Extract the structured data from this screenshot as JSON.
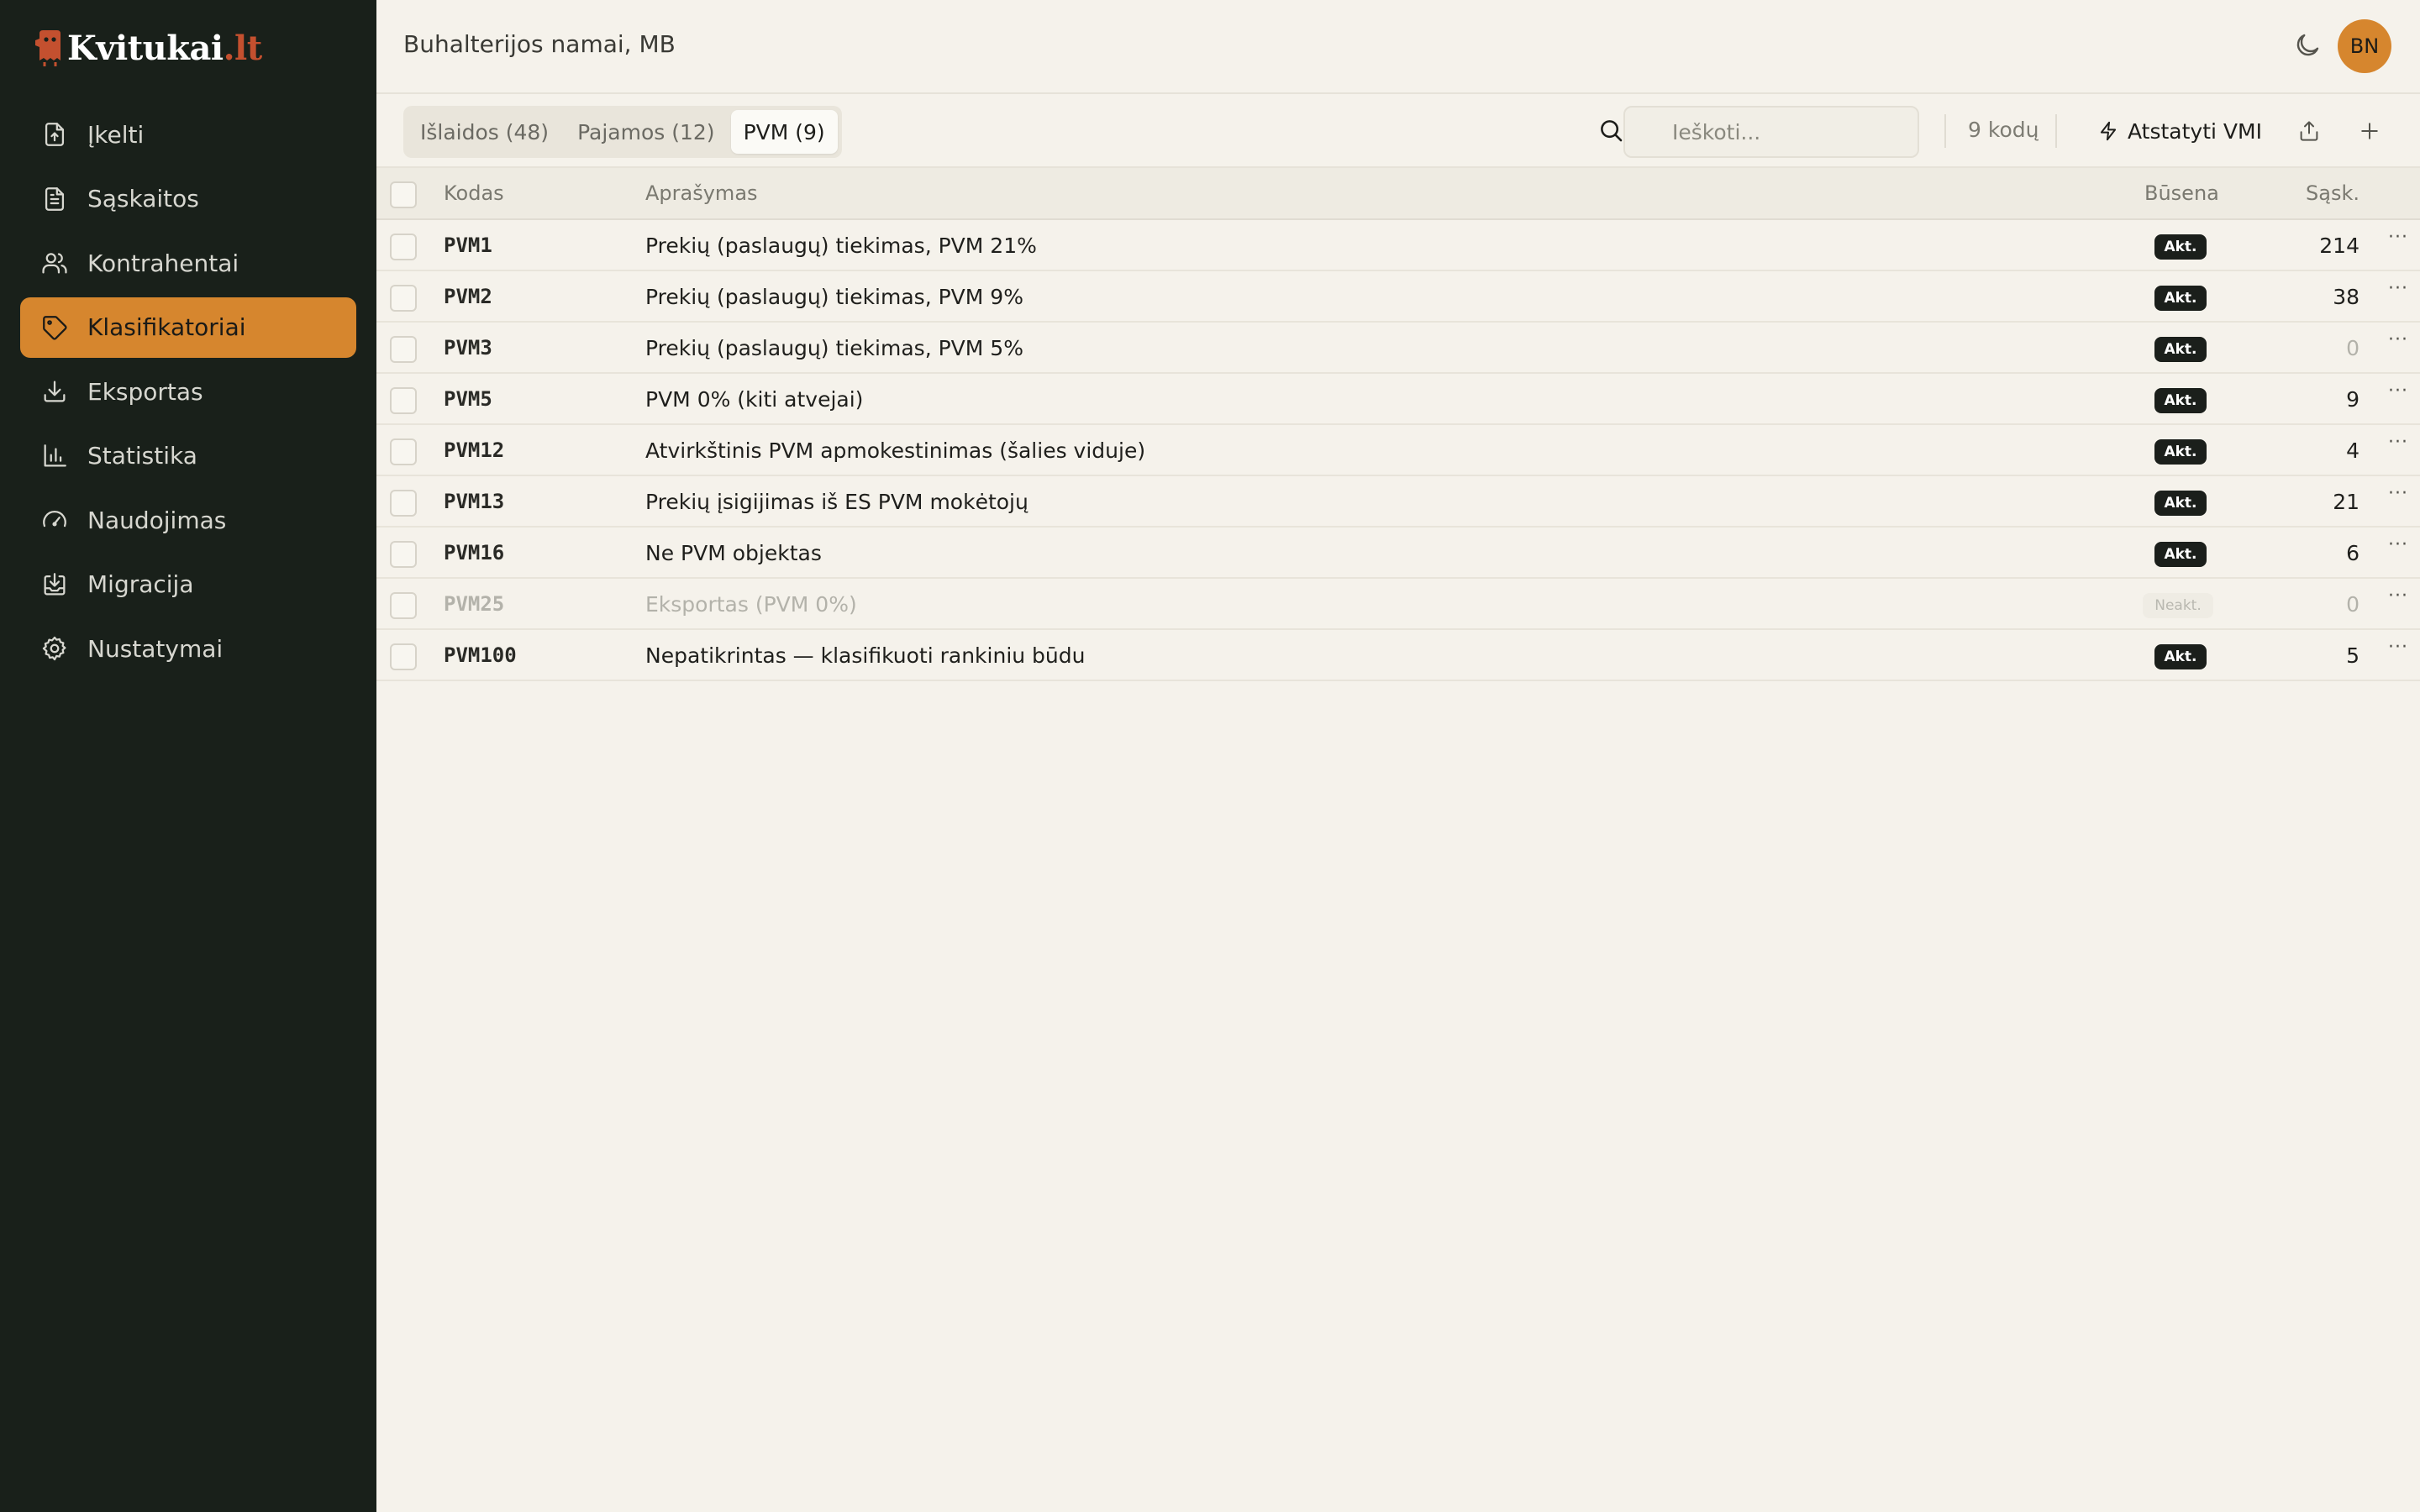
{
  "app": {
    "logo_text": "Kvitukai",
    "logo_tld": ".lt",
    "brand_color": "#d6862e",
    "accent_red": "#c4502f"
  },
  "sidebar": {
    "items": [
      {
        "label": "Įkelti",
        "icon": "upload-file-icon",
        "active": false
      },
      {
        "label": "Sąskaitos",
        "icon": "document-icon",
        "active": false
      },
      {
        "label": "Kontrahentai",
        "icon": "users-icon",
        "active": false
      },
      {
        "label": "Klasifikatoriai",
        "icon": "tag-icon",
        "active": true
      },
      {
        "label": "Eksportas",
        "icon": "download-icon",
        "active": false
      },
      {
        "label": "Statistika",
        "icon": "bar-chart-icon",
        "active": false
      },
      {
        "label": "Naudojimas",
        "icon": "gauge-icon",
        "active": false
      },
      {
        "label": "Migracija",
        "icon": "import-icon",
        "active": false
      },
      {
        "label": "Nustatymai",
        "icon": "gear-icon",
        "active": false
      }
    ]
  },
  "header": {
    "org_name": "Buhalterijos namai, MB",
    "avatar_initials": "BN"
  },
  "toolbar": {
    "tabs": [
      {
        "label": "Išlaidos (48)",
        "active": false
      },
      {
        "label": "Pajamos (12)",
        "active": false
      },
      {
        "label": "PVM (9)",
        "active": true
      }
    ],
    "search_placeholder": "Ieškoti...",
    "code_count": "9 kodų",
    "reset_label": "Atstatyti VMI"
  },
  "table": {
    "columns": {
      "code": "Kodas",
      "description": "Aprašymas",
      "status": "Būsena",
      "invoices": "Sąsk."
    },
    "rows": [
      {
        "code": "PVM1",
        "description": "Prekių (paslaugų) tiekimas, PVM 21%",
        "status": "Akt.",
        "active": true,
        "count": "214"
      },
      {
        "code": "PVM2",
        "description": "Prekių (paslaugų) tiekimas, PVM 9%",
        "status": "Akt.",
        "active": true,
        "count": "38"
      },
      {
        "code": "PVM3",
        "description": "Prekių (paslaugų) tiekimas, PVM 5%",
        "status": "Akt.",
        "active": true,
        "count": "0"
      },
      {
        "code": "PVM5",
        "description": "PVM 0% (kiti atvejai)",
        "status": "Akt.",
        "active": true,
        "count": "9"
      },
      {
        "code": "PVM12",
        "description": "Atvirkštinis PVM apmokestinimas (šalies viduje)",
        "status": "Akt.",
        "active": true,
        "count": "4"
      },
      {
        "code": "PVM13",
        "description": "Prekių įsigijimas iš ES PVM mokėtojų",
        "status": "Akt.",
        "active": true,
        "count": "21"
      },
      {
        "code": "PVM16",
        "description": "Ne PVM objektas",
        "status": "Akt.",
        "active": true,
        "count": "6"
      },
      {
        "code": "PVM25",
        "description": "Eksportas (PVM 0%)",
        "status": "Neakt.",
        "active": false,
        "count": "0"
      },
      {
        "code": "PVM100",
        "description": "Nepatikrintas — klasifikuoti rankiniu būdu",
        "status": "Akt.",
        "active": true,
        "count": "5"
      }
    ],
    "row_menu_glyph": "···"
  }
}
